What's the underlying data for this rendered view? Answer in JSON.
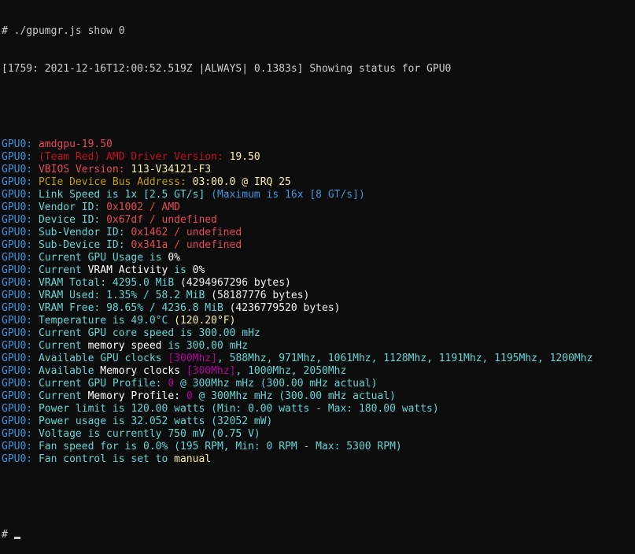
{
  "prompt": "# ./gpumgr.js show 0",
  "log_line": "[1759: 2021-12-16T12:00:52.519Z |ALWAYS| 0.1383s] Showing status for GPU0",
  "prefix": "GPU0: ",
  "lines": [
    [
      {
        "t": "amdgpu-19.50",
        "c": "c-red"
      }
    ],
    [
      {
        "t": "(Team Red) AMD Driver Version: ",
        "c": "c-dred"
      },
      {
        "t": "19.50",
        "c": "c-yel"
      }
    ],
    [
      {
        "t": "VBIOS Version: ",
        "c": "c-red"
      },
      {
        "t": "113-V34121-F3",
        "c": "c-yel"
      }
    ],
    [
      {
        "t": "PCIe Device Bus Address: ",
        "c": "c-gold"
      },
      {
        "t": "03:00.0 @ IRQ 25",
        "c": "c-yel"
      }
    ],
    [
      {
        "t": "Link Speed is 1x [2.5 GT/s] ",
        "c": "c-cyan2"
      },
      {
        "t": "(Maximum is 16x [8 GT/s])",
        "c": "c-cyan"
      }
    ],
    [
      {
        "t": "Vendor ID: ",
        "c": "c-cyan2"
      },
      {
        "t": "0x1002 / AMD",
        "c": "c-red"
      }
    ],
    [
      {
        "t": "Device ID: ",
        "c": "c-cyan2"
      },
      {
        "t": "0x67df / undefined",
        "c": "c-red"
      }
    ],
    [
      {
        "t": "Sub-Vendor ID: ",
        "c": "c-cyan2"
      },
      {
        "t": "0x1462 / undefined",
        "c": "c-red"
      }
    ],
    [
      {
        "t": "Sub-Device ID: ",
        "c": "c-cyan2"
      },
      {
        "t": "0x341a / undefined",
        "c": "c-red"
      }
    ],
    [
      {
        "t": "Current ",
        "c": "c-cyan2"
      },
      {
        "t": "GPU Usage",
        "c": "c-cyan2"
      },
      {
        "t": " is ",
        "c": "c-cyan2"
      },
      {
        "t": "0%",
        "c": "c-bwhite"
      }
    ],
    [
      {
        "t": "Current ",
        "c": "c-cyan2"
      },
      {
        "t": "VRAM Activity",
        "c": "c-bwhite"
      },
      {
        "t": " is ",
        "c": "c-cyan2"
      },
      {
        "t": "0%",
        "c": "c-bwhite"
      }
    ],
    [
      {
        "t": "VRAM Total: ",
        "c": "c-cyan2"
      },
      {
        "t": "4295.0 MiB ",
        "c": "c-cyan2"
      },
      {
        "t": "(4294967296 bytes)",
        "c": "c-white"
      }
    ],
    [
      {
        "t": "VRAM Used: ",
        "c": "c-cyan2"
      },
      {
        "t": "1.35% / 58.2 MiB ",
        "c": "c-cyan2"
      },
      {
        "t": "(58187776 bytes)",
        "c": "c-white"
      }
    ],
    [
      {
        "t": "VRAM Free: ",
        "c": "c-cyan2"
      },
      {
        "t": "98.65% / 4236.8 MiB ",
        "c": "c-cyan2"
      },
      {
        "t": "(4236779520 bytes)",
        "c": "c-white"
      }
    ],
    [
      {
        "t": "Temperature is 49.0°C ",
        "c": "c-cyan2"
      },
      {
        "t": "(120.20°F)",
        "c": "c-yel"
      }
    ],
    [
      {
        "t": "Current GPU core speed is 300.00 mHz",
        "c": "c-cyan2"
      }
    ],
    [
      {
        "t": "Current ",
        "c": "c-cyan2"
      },
      {
        "t": "memory speed",
        "c": "c-bwhite"
      },
      {
        "t": " is 300.00 mHz",
        "c": "c-cyan2"
      }
    ],
    [
      {
        "t": "Available GPU clocks ",
        "c": "c-cyan2"
      },
      {
        "t": "[300Mhz]",
        "c": "c-mag"
      },
      {
        "t": ", 588Mhz, 971Mhz, 1061Mhz, 1128Mhz, 1191Mhz, 1195Mhz, 1200Mhz",
        "c": "c-cyan2"
      }
    ],
    [
      {
        "t": "Available ",
        "c": "c-cyan2"
      },
      {
        "t": "Memory clocks",
        "c": "c-bwhite"
      },
      {
        "t": " ",
        "c": "c-cyan2"
      },
      {
        "t": "[300Mhz]",
        "c": "c-mag"
      },
      {
        "t": ", 1000Mhz, 2050Mhz",
        "c": "c-cyan2"
      }
    ],
    [
      {
        "t": "Current GPU Profile: ",
        "c": "c-cyan2"
      },
      {
        "t": "0",
        "c": "c-mag"
      },
      {
        "t": " @ 300Mhz mHz (300.00 mHz actual)",
        "c": "c-cyan2"
      }
    ],
    [
      {
        "t": "Current ",
        "c": "c-cyan2"
      },
      {
        "t": "Memory Profile:",
        "c": "c-bwhite"
      },
      {
        "t": " ",
        "c": "c-cyan2"
      },
      {
        "t": "0",
        "c": "c-mag"
      },
      {
        "t": " @ 300Mhz mHz (300.00 mHz actual)",
        "c": "c-cyan2"
      }
    ],
    [
      {
        "t": "Power limit is 120.00 watts (Min: 0.00 watts - Max: 180.00 watts)",
        "c": "c-cyan2"
      }
    ],
    [
      {
        "t": "Power usage is 32.052 watts (32052 mW)",
        "c": "c-cyan2"
      }
    ],
    [
      {
        "t": "Voltage is currently 750 mV (0.75 V)",
        "c": "c-cyan2"
      }
    ],
    [
      {
        "t": "Fan speed for is 0.0% (195 RPM, Min: 0 RPM - Max: 5300 RPM)",
        "c": "c-cyan2"
      }
    ],
    [
      {
        "t": "Fan control is set to ",
        "c": "c-cyan2"
      },
      {
        "t": "manual",
        "c": "c-yel"
      }
    ]
  ],
  "final_prompt": "# ",
  "colors": {
    "background": "#0c0c0c",
    "default_text": "#cccccc",
    "prefix": "#3a96dd",
    "label": "#61d6d6",
    "error_value": "#e74856",
    "highlight": "#f9f1a5",
    "selected_clock": "#b4009e"
  }
}
